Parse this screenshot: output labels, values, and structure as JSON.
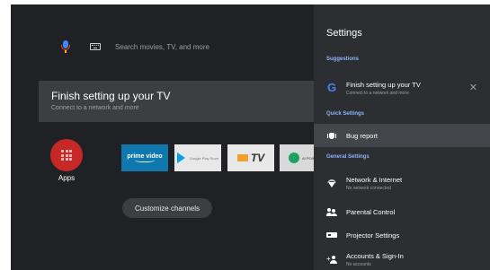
{
  "home": {
    "search_placeholder": "Search movies, TV, and more",
    "setup_banner": {
      "title": "Finish setting up your TV",
      "subtitle": "Connect to a network and more"
    },
    "apps_label": "Apps",
    "channels": {
      "prime_video": "prime video",
      "google_play": "Google Play Store",
      "tv": "TV",
      "ai_point": "AI POINT"
    },
    "customize_channels": "Customize channels"
  },
  "settings": {
    "title": "Settings",
    "suggestions_label": "Suggestions",
    "suggestion": {
      "title": "Finish setting up your TV",
      "subtitle": "Connect to a network and more"
    },
    "quick_settings_label": "Quick Settings",
    "bug_report": "Bug report",
    "general_settings_label": "General Settings",
    "network": {
      "title": "Network & Internet",
      "subtitle": "No network connected"
    },
    "parental_control": "Parental Control",
    "projector_settings": "Projector Settings",
    "accounts": {
      "title": "Accounts & Sign-In",
      "subtitle": "No accounts"
    }
  },
  "colors": {
    "background": "#202124",
    "panel": "#2d2e31",
    "accent": "#8ab4f8",
    "apps_tile": "#c62828"
  }
}
